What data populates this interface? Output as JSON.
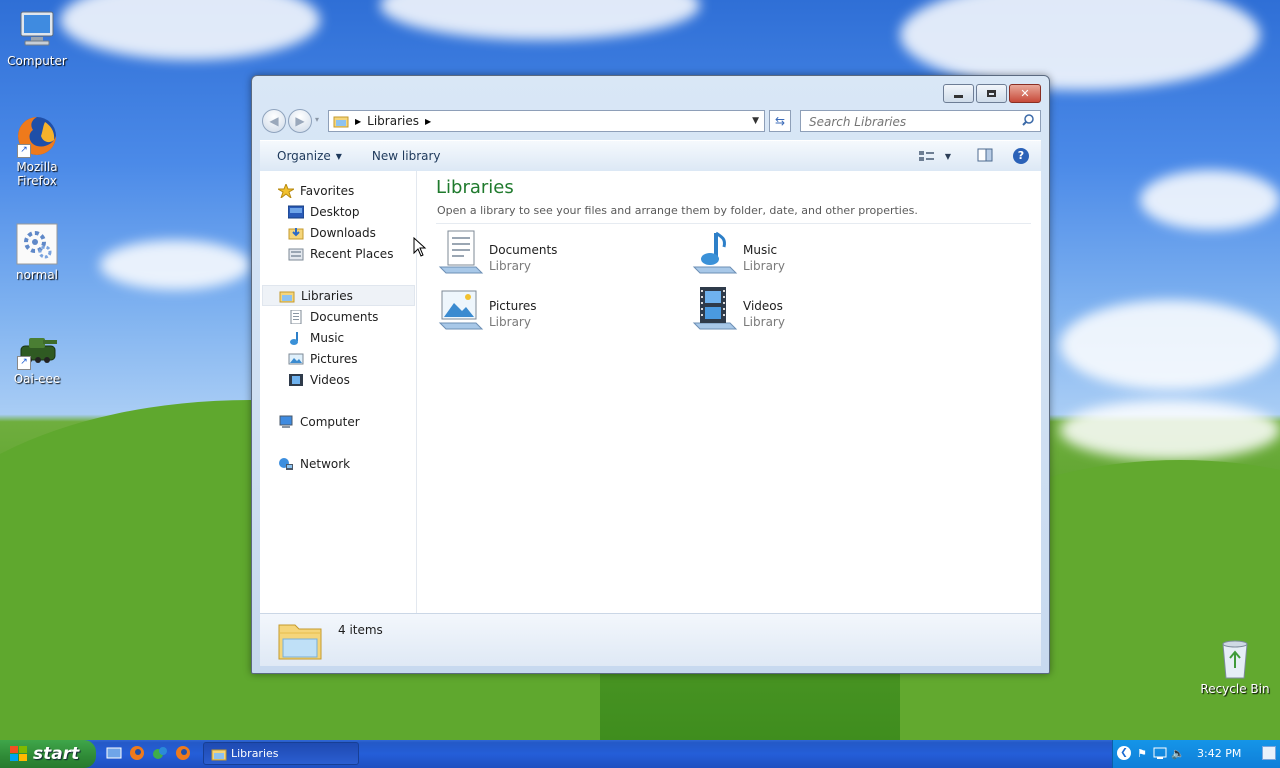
{
  "desktop": {
    "icons": [
      {
        "label": "Computer"
      },
      {
        "label": "Mozilla\nFirefox"
      },
      {
        "label": "normal"
      },
      {
        "label": "Oai-eee"
      },
      {
        "label": "Recycle Bin"
      }
    ]
  },
  "window": {
    "address": {
      "segment": "Libraries"
    },
    "search": {
      "placeholder": "Search Libraries"
    },
    "toolbar": {
      "organize": "Organize",
      "new_library": "New library"
    },
    "nav": {
      "favorites": "Favorites",
      "fav_items": [
        "Desktop",
        "Downloads",
        "Recent Places"
      ],
      "libraries": "Libraries",
      "lib_items": [
        "Documents",
        "Music",
        "Pictures",
        "Videos"
      ],
      "computer": "Computer",
      "network": "Network"
    },
    "main": {
      "title": "Libraries",
      "subtitle": "Open a library to see your files and arrange them by folder, date, and other properties.",
      "libraries": [
        {
          "name": "Documents",
          "type": "Library"
        },
        {
          "name": "Music",
          "type": "Library"
        },
        {
          "name": "Pictures",
          "type": "Library"
        },
        {
          "name": "Videos",
          "type": "Library"
        }
      ]
    },
    "details": {
      "count": "4 items"
    }
  },
  "taskbar": {
    "start": "start",
    "task": "Libraries",
    "clock": "3:42 PM"
  },
  "colors": {
    "title_green": "#1f7a2d",
    "taskbar_blue": "#245ed8",
    "start_green": "#3fa64a"
  }
}
